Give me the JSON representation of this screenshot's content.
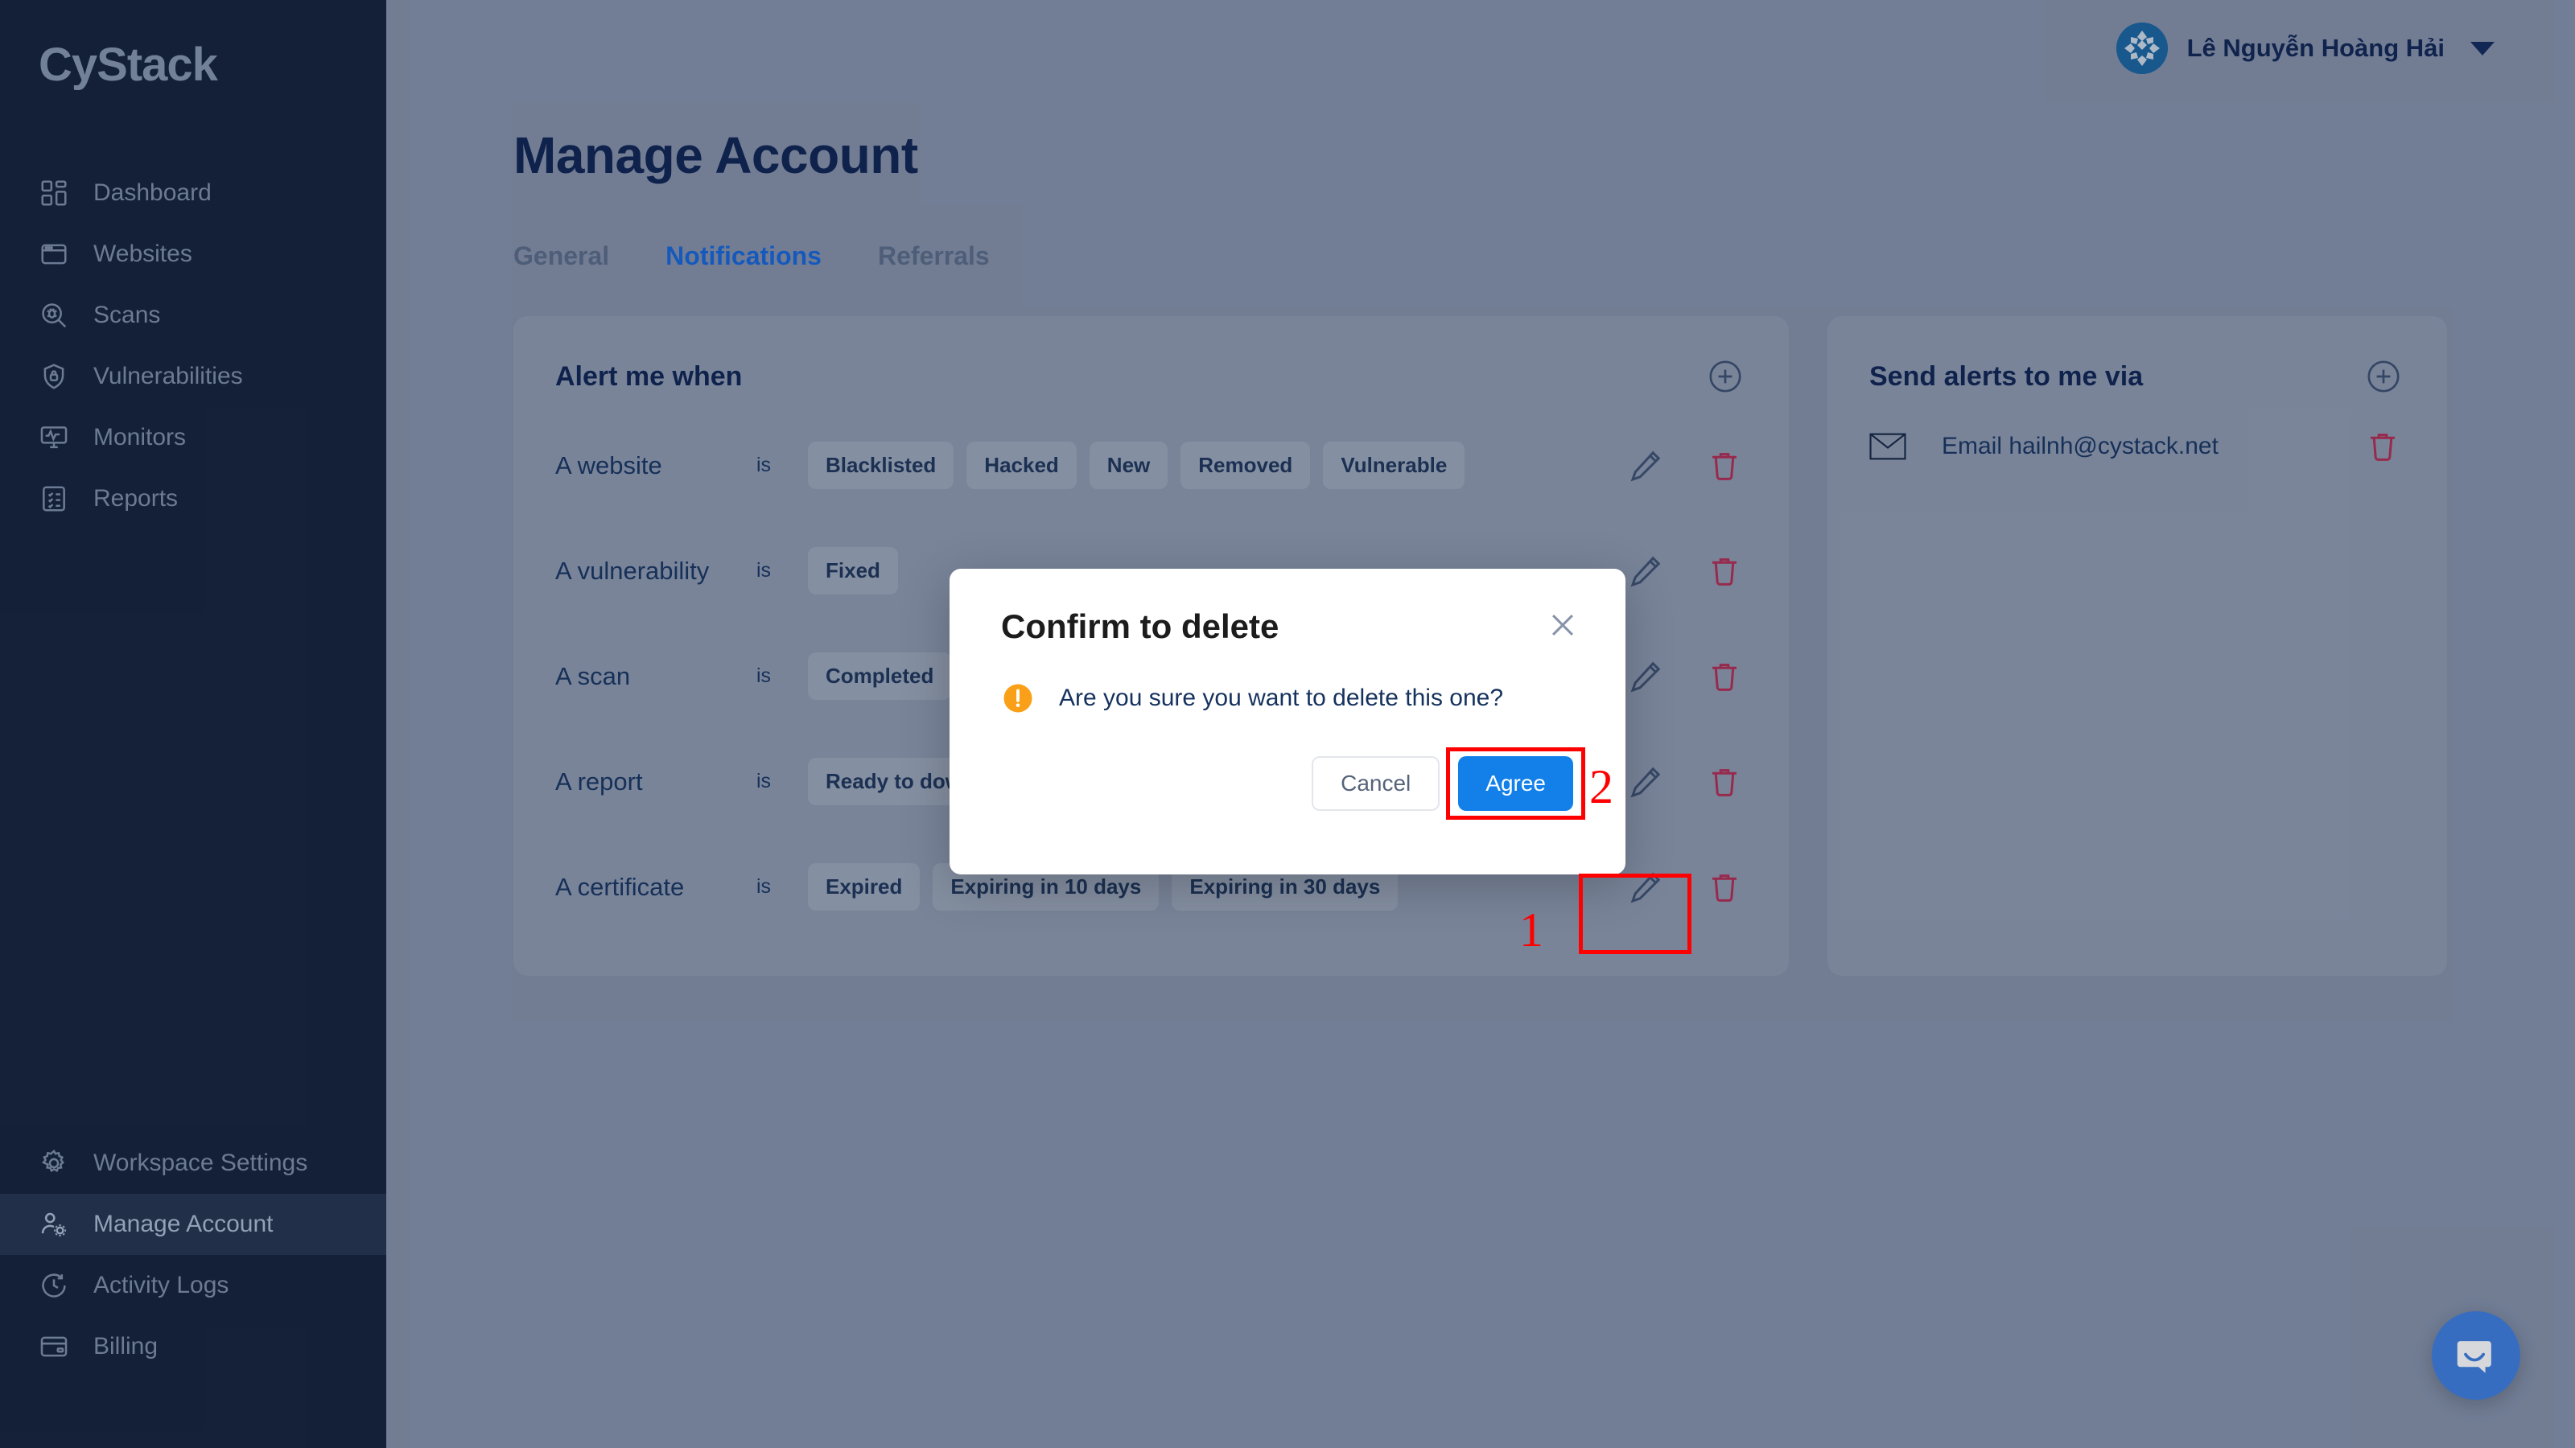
{
  "brand": {
    "logo_text": "CyStack",
    "accent": "#1565d8",
    "sidebar_bg": "#121f38",
    "page_bg": "#8591a8"
  },
  "sidebar": {
    "top_items": [
      {
        "label": "Dashboard",
        "icon": "dashboard-grid-icon"
      },
      {
        "label": "Websites",
        "icon": "browser-window-icon"
      },
      {
        "label": "Scans",
        "icon": "bug-magnifier-icon"
      },
      {
        "label": "Vulnerabilities",
        "icon": "shield-lock-icon"
      },
      {
        "label": "Monitors",
        "icon": "monitor-pulse-icon"
      },
      {
        "label": "Reports",
        "icon": "report-list-icon"
      }
    ],
    "bottom_items": [
      {
        "label": "Workspace Settings",
        "icon": "gear-icon"
      },
      {
        "label": "Manage Account",
        "icon": "user-gear-icon"
      },
      {
        "label": "Activity Logs",
        "icon": "clock-history-icon"
      },
      {
        "label": "Billing",
        "icon": "credit-card-icon"
      }
    ],
    "active_item": "Manage Account"
  },
  "topbar": {
    "user_name": "Lê Nguyễn Hoàng Hải",
    "avatar_icon": "cystack-avatar-icon",
    "caret_icon": "chevron-down-icon"
  },
  "page": {
    "title": "Manage Account",
    "tabs": [
      {
        "label": "General",
        "active": false
      },
      {
        "label": "Notifications",
        "active": true
      },
      {
        "label": "Referrals",
        "active": false
      }
    ]
  },
  "alert_card": {
    "title": "Alert me when",
    "add_icon": "plus-circle-icon",
    "edit_icon": "pencil-icon",
    "delete_icon": "trash-icon",
    "is_label": "is",
    "rows": [
      {
        "subject": "A website",
        "tags": [
          "Blacklisted",
          "Hacked",
          "New",
          "Removed",
          "Vulnerable"
        ]
      },
      {
        "subject": "A vulnerability",
        "tags": [
          "Fixed"
        ]
      },
      {
        "subject": "A scan",
        "tags": [
          "Completed"
        ]
      },
      {
        "subject": "A report",
        "tags": [
          "Ready to download"
        ]
      },
      {
        "subject": "A certificate",
        "tags": [
          "Expired",
          "Expiring in 10 days",
          "Expiring in 30 days"
        ]
      }
    ]
  },
  "via_card": {
    "title": "Send alerts to me via",
    "add_icon": "plus-circle-icon",
    "delete_icon": "trash-icon",
    "items": [
      {
        "icon": "envelope-icon",
        "text": "Email hailnh@cystack.net"
      }
    ]
  },
  "modal": {
    "title": "Confirm to delete",
    "close_icon": "close-x-icon",
    "warning_icon": "warning-exclamation-icon",
    "message": "Are you sure you want to delete this one?",
    "cancel_label": "Cancel",
    "agree_label": "Agree",
    "agree_color": "#1380ea"
  },
  "annotations": {
    "color": "#ff0000",
    "markers": [
      {
        "number": "1",
        "target": "certificate-row-edit-button"
      },
      {
        "number": "2",
        "target": "modal-agree-button"
      }
    ]
  },
  "intercom": {
    "icon": "intercom-chat-icon",
    "color": "#3d7ddf"
  }
}
